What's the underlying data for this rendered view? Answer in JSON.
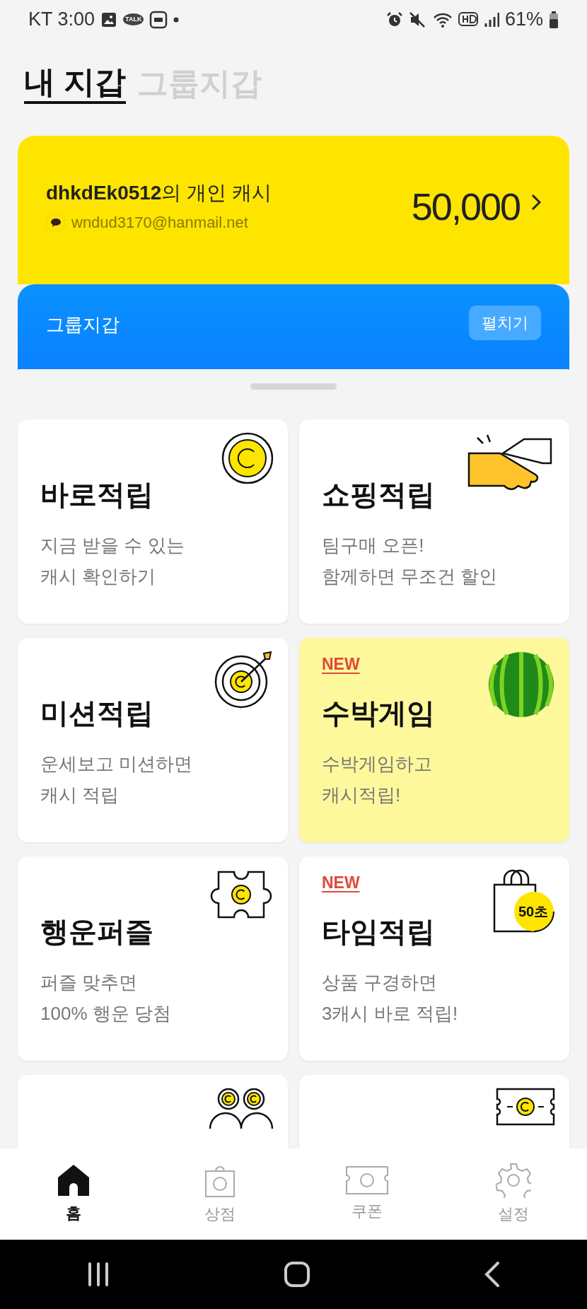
{
  "status_bar": {
    "carrier_time": "KT 3:00",
    "talk_badge": "TALK",
    "battery": "61%"
  },
  "tabs": [
    {
      "label": "내 지갑",
      "selected": true
    },
    {
      "label": "그룹지갑",
      "selected": false
    }
  ],
  "wallet": {
    "owner": "**dhkdEk0512**의 개인 캐시",
    "email": "wndud3170@hanmail.net",
    "amount": "50,000"
  },
  "group_wallet": {
    "title": "그룹지갑",
    "button": "펼치기"
  },
  "tile_rows": [
    [
      {
        "kind": "coin",
        "title": "바로적립",
        "subtitle": [
          "지금 받을 수 있는",
          "캐시 확인하기"
        ],
        "new": false,
        "highlighted": false
      },
      {
        "kind": "handshake",
        "title": "쇼핑적립",
        "subtitle": [
          "팀구매 오픈!",
          "함께하면 무조건 할인"
        ],
        "new": false,
        "highlighted": false
      }
    ],
    [
      {
        "kind": "target",
        "title": "미션적립",
        "subtitle": [
          "운세보고 미션하면",
          "캐시 적립"
        ],
        "new": false,
        "highlighted": false
      },
      {
        "kind": "watermelon",
        "title": "수박게임",
        "subtitle": [
          "수박게임하고",
          "캐시적립!"
        ],
        "new": true,
        "new_label": "NEW",
        "highlighted": true
      }
    ],
    [
      {
        "kind": "puzzle",
        "title": "행운퍼즐",
        "subtitle": [
          "퍼즐 맞추면",
          "100% 행운 당첨"
        ],
        "new": false,
        "highlighted": false
      },
      {
        "kind": "bag",
        "title": "타임적립",
        "subtitle": [
          "상품 구경하면",
          "3캐시 바로 적립!"
        ],
        "new": true,
        "new_label": "NEW",
        "highlighted": false,
        "icon_text": "50초"
      }
    ],
    [
      {
        "kind": "people",
        "new": false,
        "highlighted": false
      },
      {
        "kind": "ticket",
        "new": false,
        "highlighted": false
      }
    ]
  ],
  "bottom_nav": [
    {
      "kind": "home",
      "label": "홈",
      "selected": true
    },
    {
      "kind": "shop",
      "label": "상점",
      "selected": false
    },
    {
      "kind": "coupon",
      "label": "쿠폰",
      "selected": false
    },
    {
      "kind": "settings",
      "label": "설정",
      "selected": false
    }
  ]
}
